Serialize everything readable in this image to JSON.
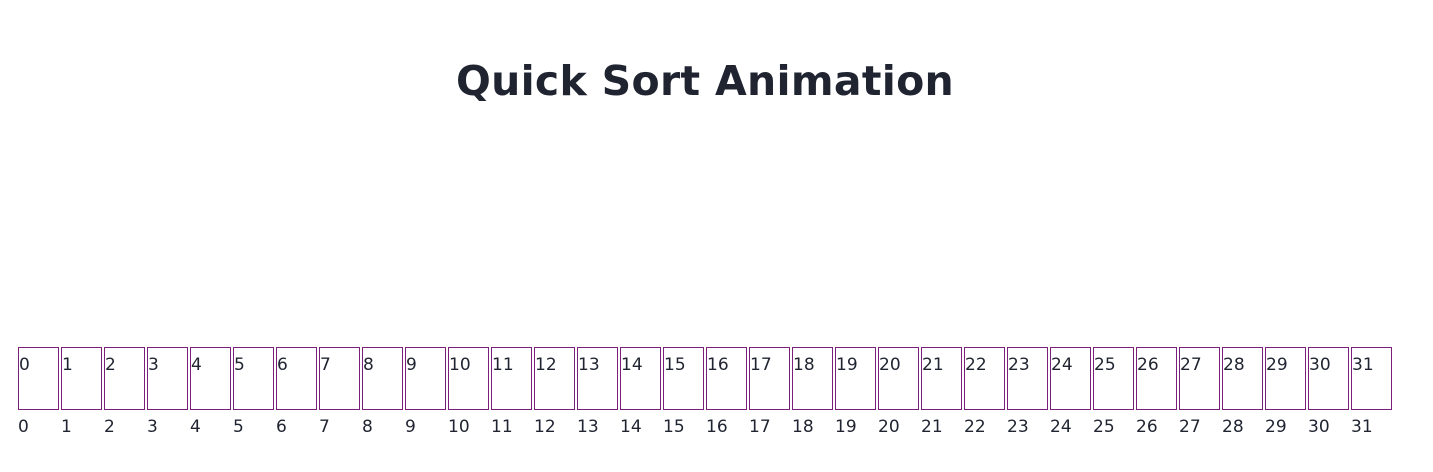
{
  "header": {
    "title": "Quick Sort Animation"
  },
  "colors": {
    "bar_border": "#7a1f7a",
    "text": "#1f2430"
  },
  "array": {
    "values": [
      0,
      1,
      2,
      3,
      4,
      5,
      6,
      7,
      8,
      9,
      10,
      11,
      12,
      13,
      14,
      15,
      16,
      17,
      18,
      19,
      20,
      21,
      22,
      23,
      24,
      25,
      26,
      27,
      28,
      29,
      30,
      31
    ],
    "indices": [
      "0",
      "1",
      "2",
      "3",
      "4",
      "5",
      "6",
      "7",
      "8",
      "9",
      "10",
      "11",
      "12",
      "13",
      "14",
      "15",
      "16",
      "17",
      "18",
      "19",
      "20",
      "21",
      "22",
      "23",
      "24",
      "25",
      "26",
      "27",
      "28",
      "29",
      "30",
      "31"
    ]
  }
}
